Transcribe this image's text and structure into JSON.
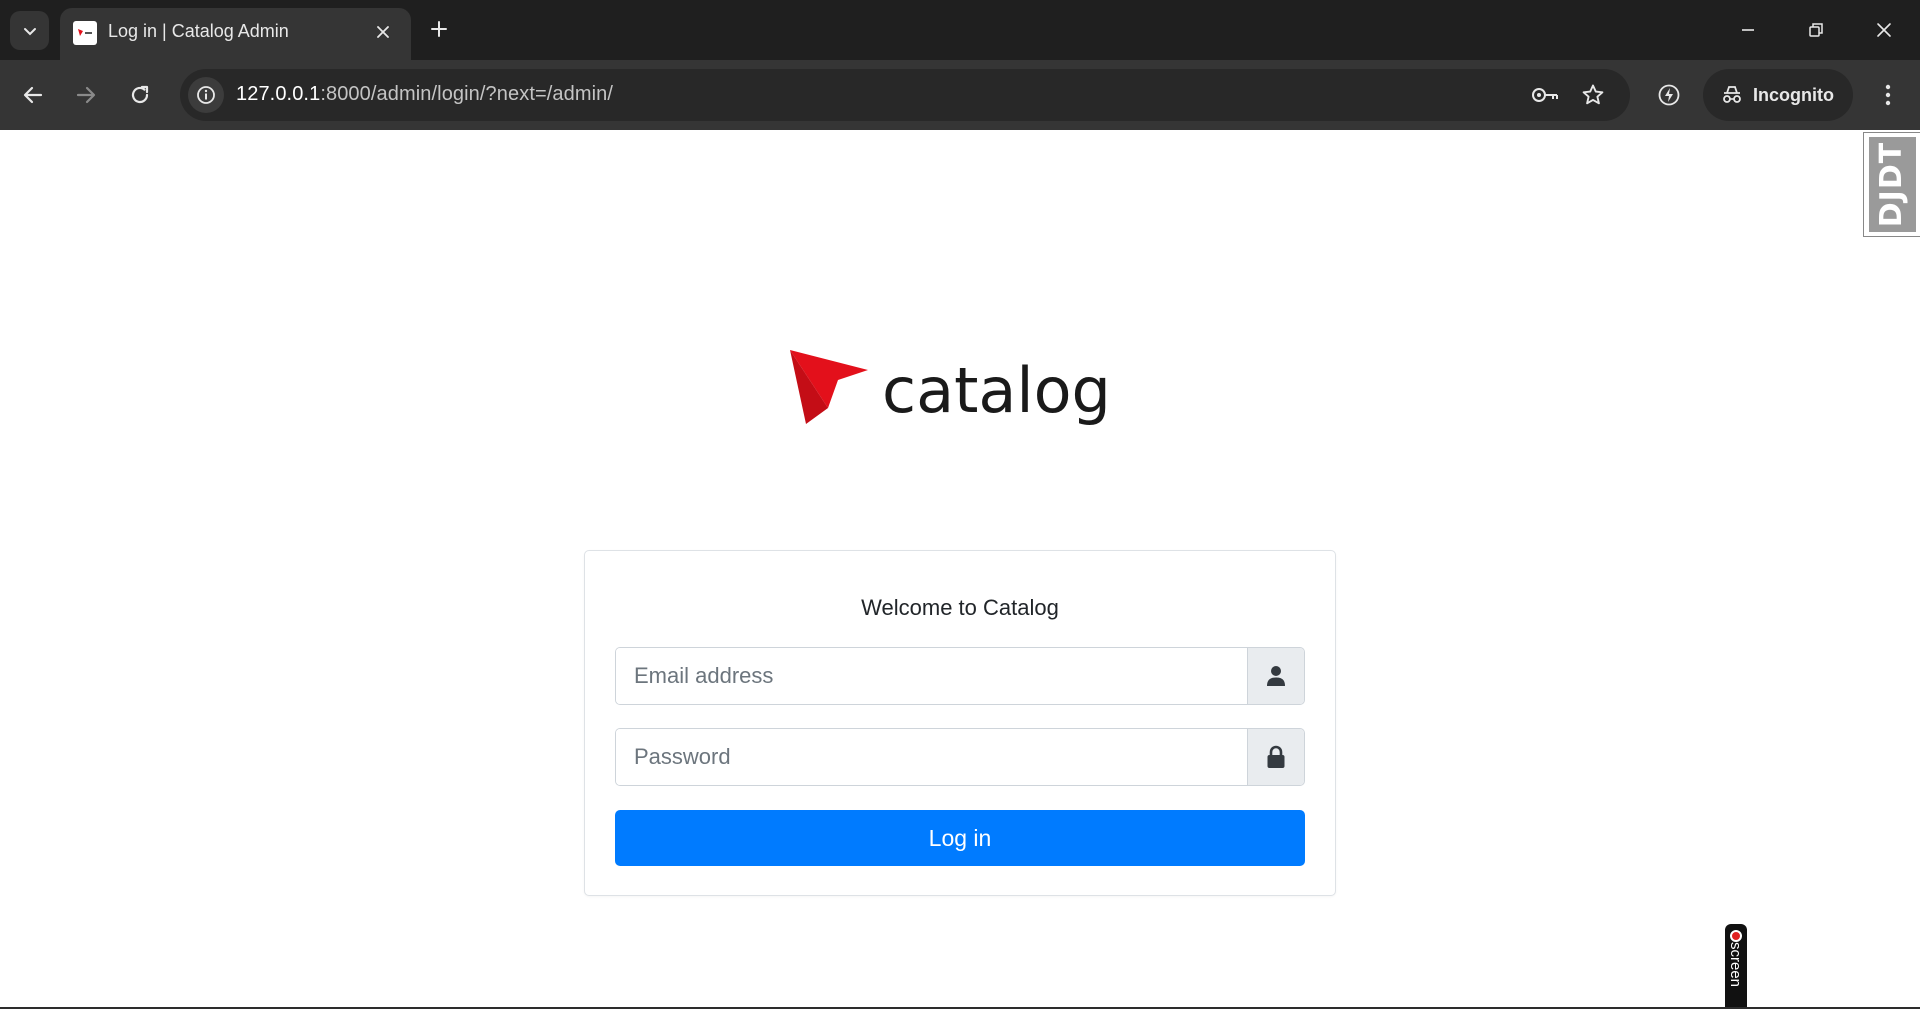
{
  "browser": {
    "tab_title": "Log in | Catalog Admin",
    "url_host": "127.0.0.1",
    "url_rest": ":8000/admin/login/?next=/admin/",
    "incognito_label": "Incognito"
  },
  "page": {
    "logo_text": "catalog",
    "welcome": "Welcome to Catalog",
    "email_placeholder": "Email address",
    "email_icon": "user-icon",
    "password_placeholder": "Password",
    "password_icon": "lock-icon",
    "login_label": "Log in",
    "debug_toolbar_label": "DJDT",
    "screen_recorder_label": "screen"
  },
  "colors": {
    "brand_red": "#e3101b",
    "primary_button": "#007bff"
  }
}
